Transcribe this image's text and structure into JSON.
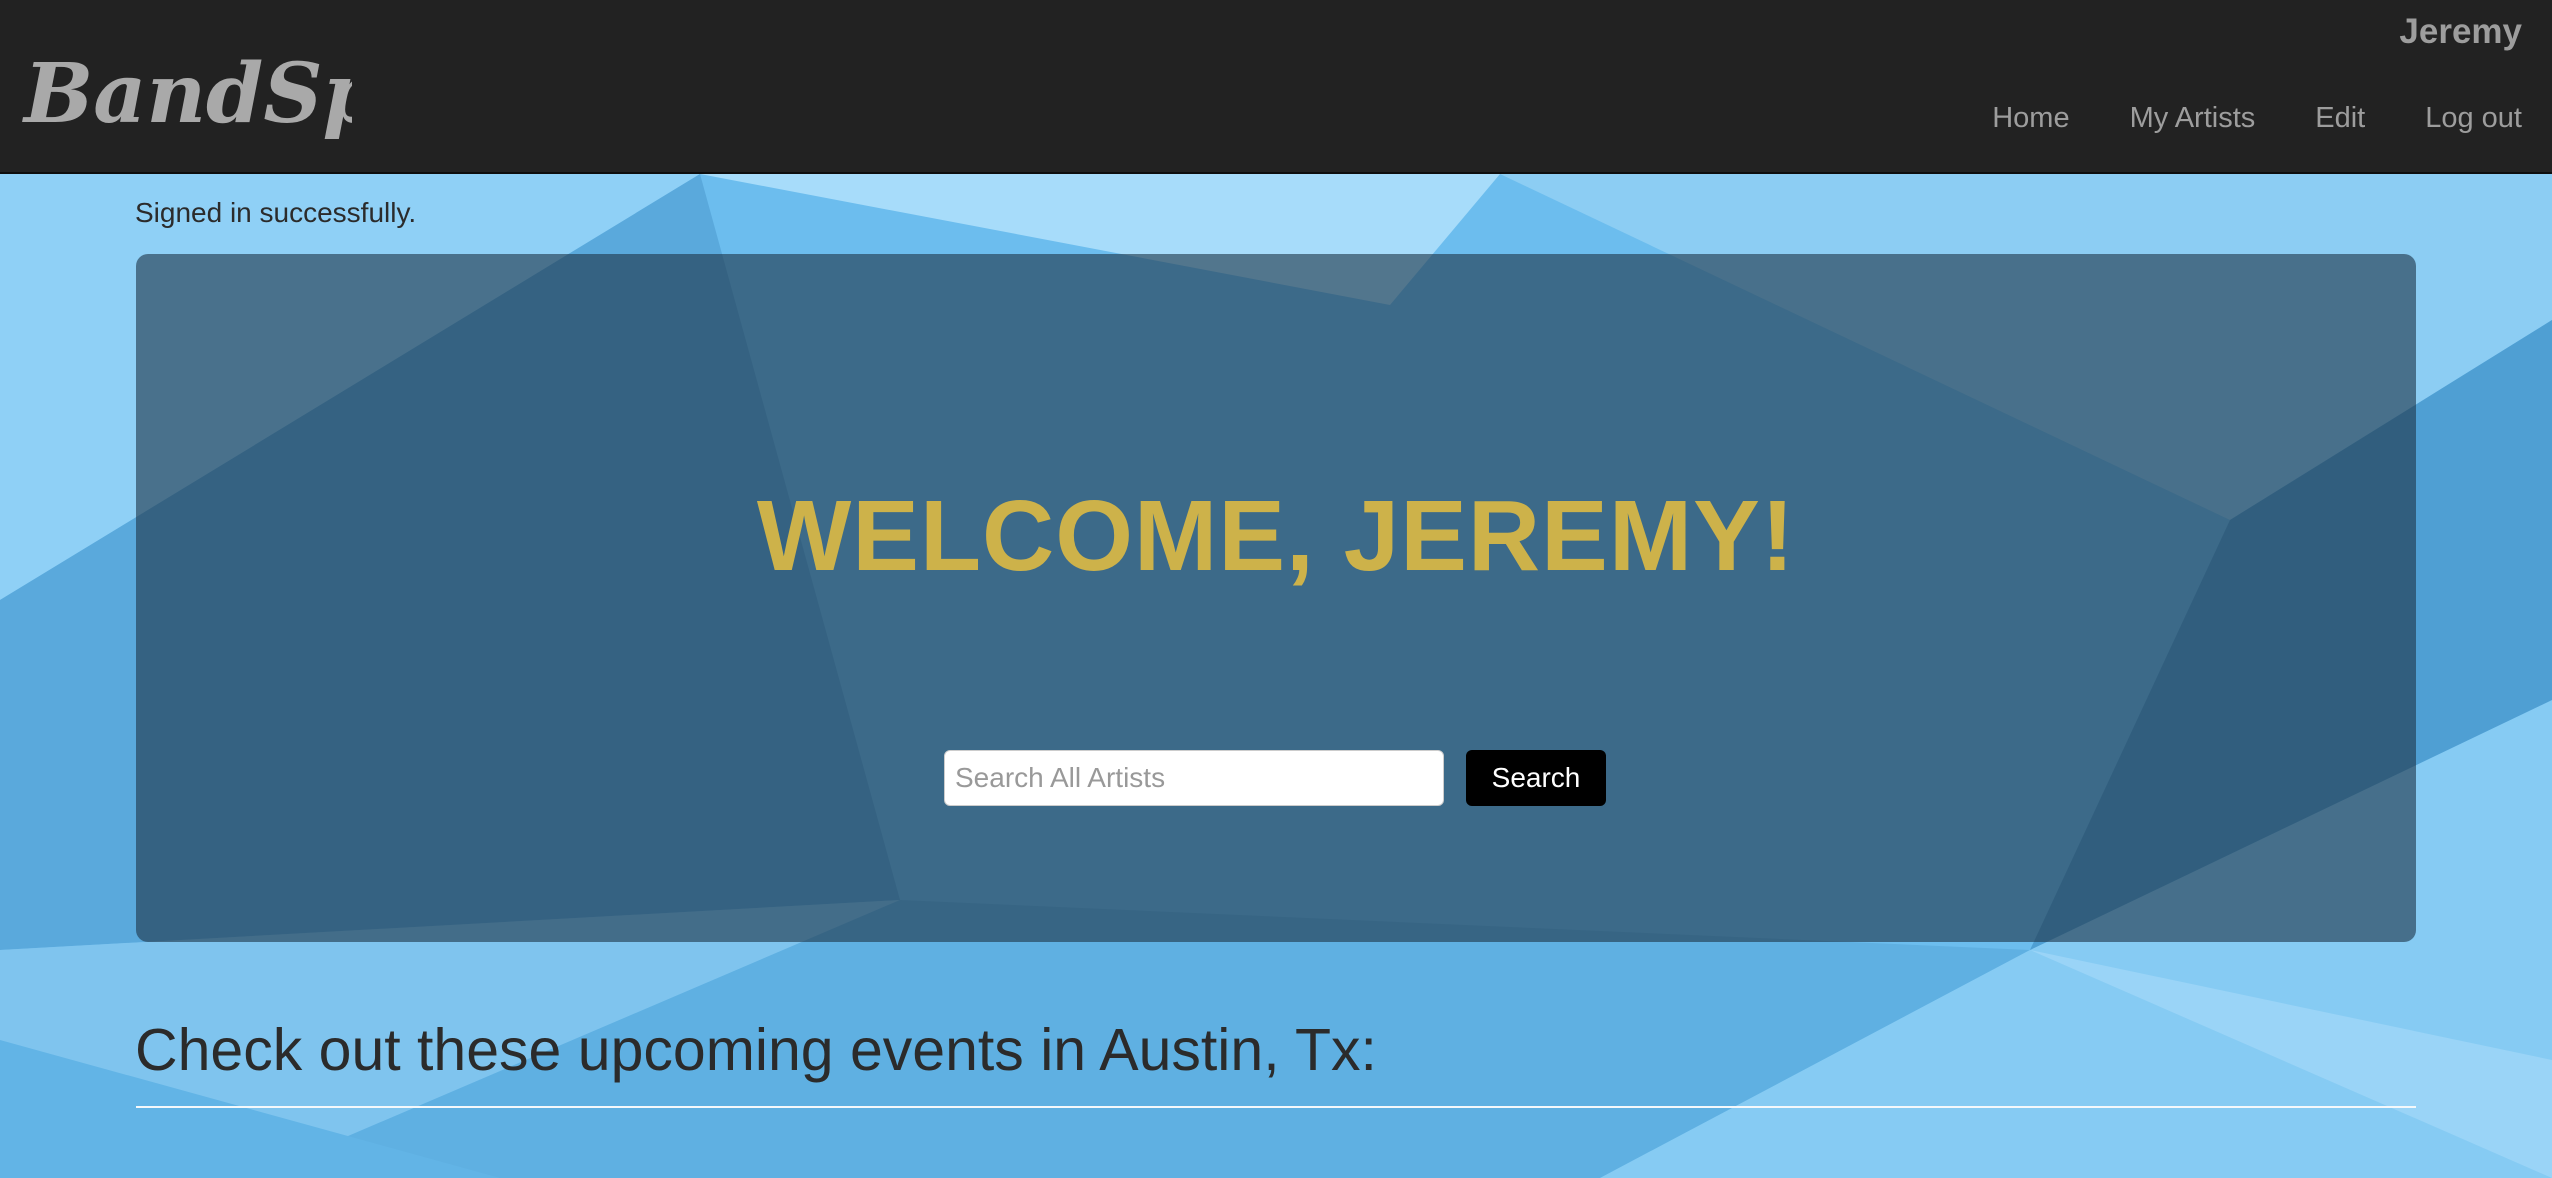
{
  "navbar": {
    "brand": "BandSpy",
    "user_name": "Jeremy",
    "links": [
      {
        "label": "Home"
      },
      {
        "label": "My Artists"
      },
      {
        "label": "Edit"
      },
      {
        "label": "Log out"
      }
    ]
  },
  "flash": {
    "message": "Signed in successfully."
  },
  "hero": {
    "welcome": "WELCOME, JEREMY!",
    "search_placeholder": "Search All Artists",
    "search_value": "",
    "search_button": "Search"
  },
  "events": {
    "heading": "Check out these upcoming events in Austin, Tx:"
  },
  "colors": {
    "navbar_bg": "#222222",
    "nav_text": "#9d9d9d",
    "page_bg": "#6cbdee",
    "welcome_text": "#cdb24a",
    "search_button_bg": "#000000"
  }
}
